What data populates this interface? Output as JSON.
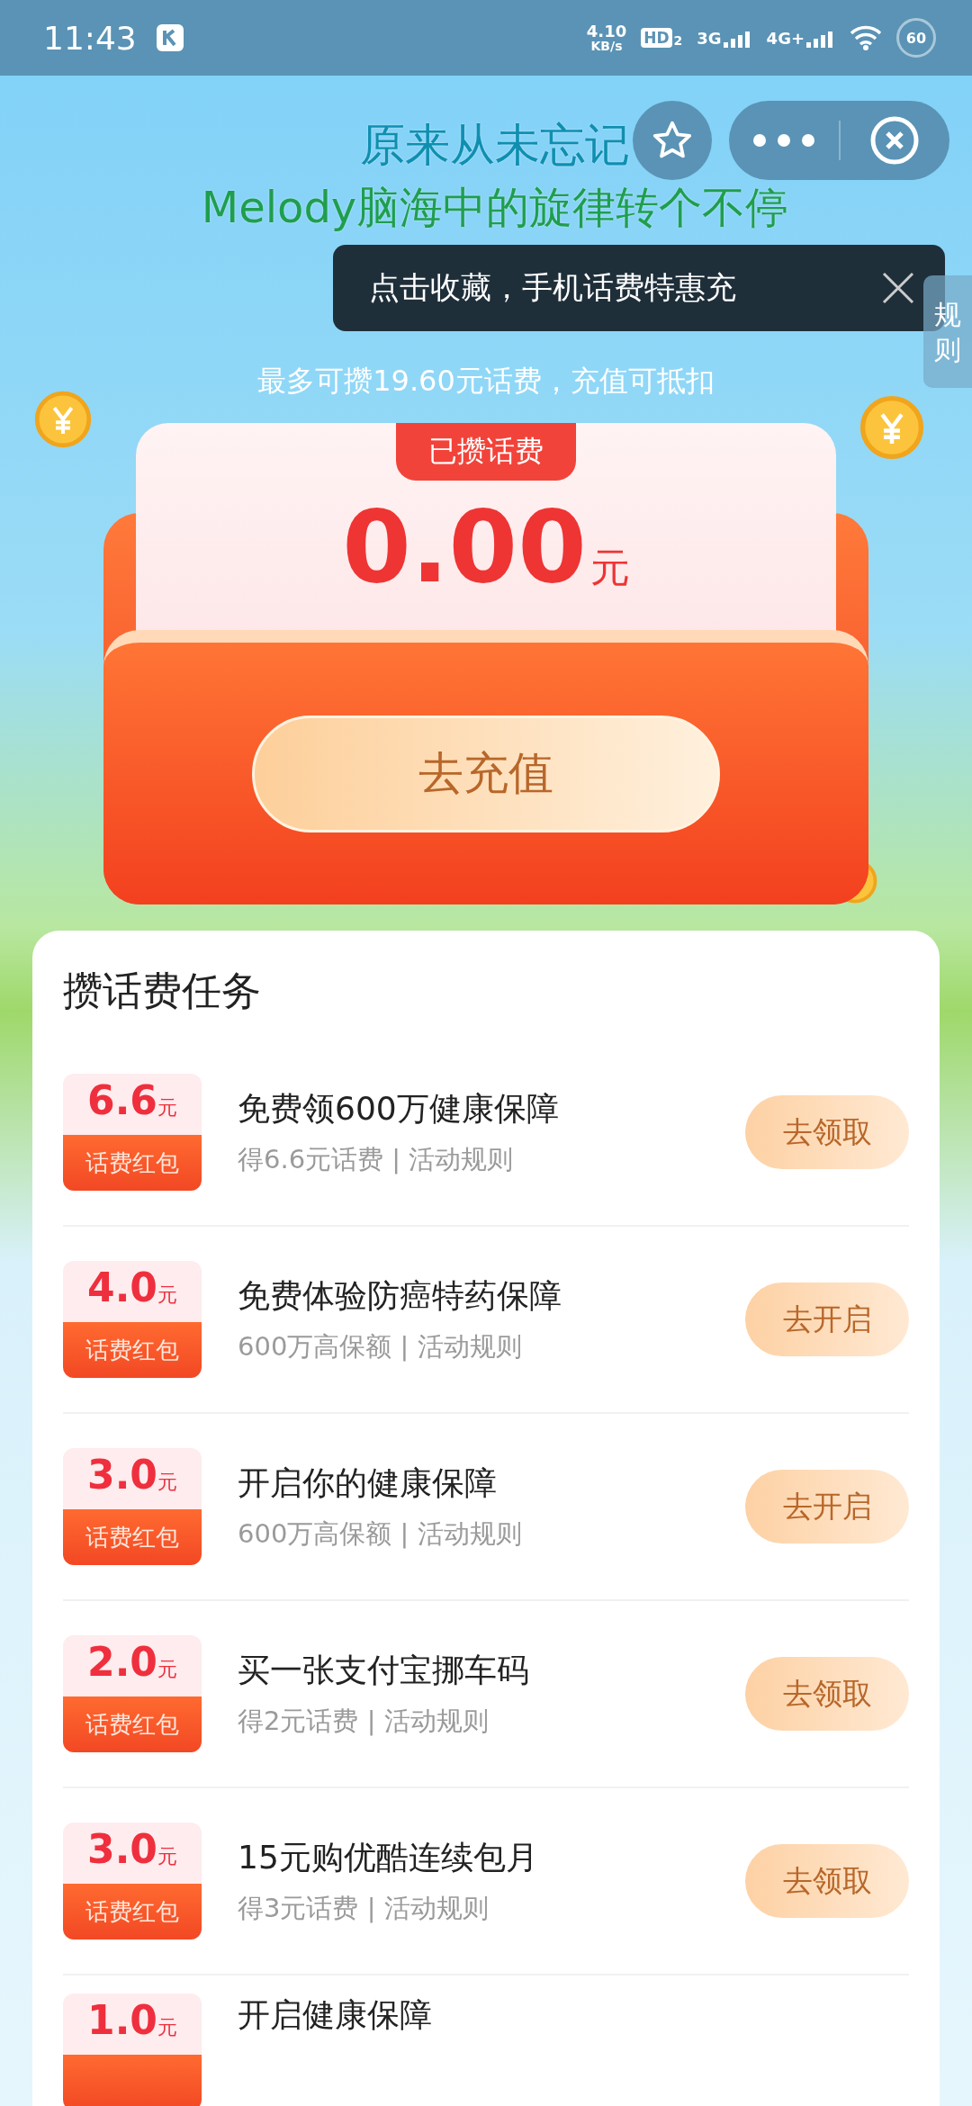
{
  "status_bar": {
    "time": "11:43",
    "net_speed": "4.10",
    "net_unit": "KB/s",
    "hd": "HD",
    "hd_sub": "2",
    "net_3g": "3G",
    "net_4g": "4G+",
    "battery": "60"
  },
  "lyrics": [
    "原来从未忘记",
    "Melody脑海中的旋律转个不停"
  ],
  "favorite_tip": {
    "text": "点击收藏，手机话费特惠充"
  },
  "rules_tab": {
    "label": "规则"
  },
  "subtitle": "最多可攒19.60元话费，充值可抵扣",
  "envelope": {
    "tag": "已攒话费",
    "amount": "0.00",
    "unit": "元",
    "button": "去充值"
  },
  "tasks": {
    "title": "攒话费任务",
    "items": [
      {
        "amount": "6.6",
        "unit": "元",
        "badge_label": "话费红包",
        "title": "免费领600万健康保障",
        "subtitle": "得6.6元话费 | 活动规则",
        "button": "去领取"
      },
      {
        "amount": "4.0",
        "unit": "元",
        "badge_label": "话费红包",
        "title": "免费体验防癌特药保障",
        "subtitle": "600万高保额 | 活动规则",
        "button": "去开启"
      },
      {
        "amount": "3.0",
        "unit": "元",
        "badge_label": "话费红包",
        "title": "开启你的健康保障",
        "subtitle": "600万高保额 | 活动规则",
        "button": "去开启"
      },
      {
        "amount": "2.0",
        "unit": "元",
        "badge_label": "话费红包",
        "title": "买一张支付宝挪车码",
        "subtitle": "得2元话费 | 活动规则",
        "button": "去领取"
      },
      {
        "amount": "3.0",
        "unit": "元",
        "badge_label": "话费红包",
        "title": "15元购优酷连续包月",
        "subtitle": "得3元话费 | 活动规则",
        "button": "去领取"
      },
      {
        "amount": "1.0",
        "unit": "元",
        "title": "开启健康保障"
      }
    ]
  }
}
